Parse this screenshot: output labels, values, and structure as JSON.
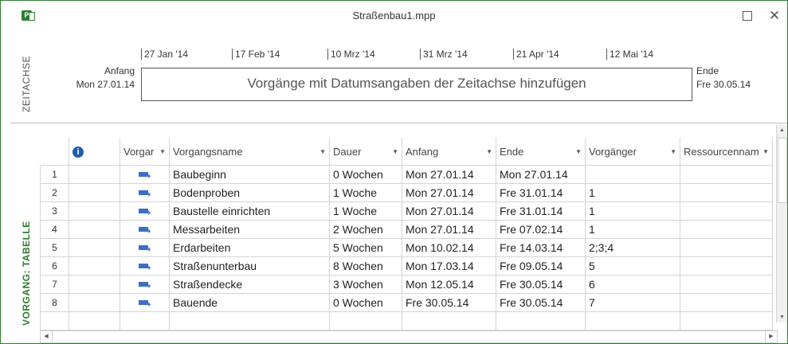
{
  "window": {
    "title": "Straßenbau1.mpp"
  },
  "timeline": {
    "side_label": "ZEITACHSE",
    "start_label": "Anfang",
    "start_date": "Mon 27.01.14",
    "end_label": "Ende",
    "end_date": "Fre 30.05.14",
    "hint": "Vorgänge mit Datumsangaben der Zeitachse hinzufügen",
    "ticks": [
      "27 Jan '14",
      "17 Feb '14",
      "10 Mrz '14",
      "31 Mrz '14",
      "21 Apr '14",
      "12 Mai '14"
    ]
  },
  "table": {
    "side_label": "VORGANG: TABELLE",
    "columns": {
      "info": "i",
      "mode": "Vorgar",
      "name": "Vorgangsname",
      "duration": "Dauer",
      "start": "Anfang",
      "finish": "Ende",
      "predecessors": "Vorgänger",
      "resources": "Ressourcennam"
    },
    "rows": [
      {
        "id": "1",
        "name": "Baubeginn",
        "duration": "0 Wochen",
        "start": "Mon 27.01.14",
        "finish": "Mon 27.01.14",
        "pred": ""
      },
      {
        "id": "2",
        "name": "Bodenproben",
        "duration": "1 Woche",
        "start": "Mon 27.01.14",
        "finish": "Fre 31.01.14",
        "pred": "1"
      },
      {
        "id": "3",
        "name": "Baustelle einrichten",
        "duration": "1 Woche",
        "start": "Mon 27.01.14",
        "finish": "Fre 31.01.14",
        "pred": "1"
      },
      {
        "id": "4",
        "name": "Messarbeiten",
        "duration": "2 Wochen",
        "start": "Mon 27.01.14",
        "finish": "Fre 07.02.14",
        "pred": "1"
      },
      {
        "id": "5",
        "name": "Erdarbeiten",
        "duration": "5 Wochen",
        "start": "Mon 10.02.14",
        "finish": "Fre 14.03.14",
        "pred": "2;3;4"
      },
      {
        "id": "6",
        "name": "Straßenunterbau",
        "duration": "8 Wochen",
        "start": "Mon 17.03.14",
        "finish": "Fre 09.05.14",
        "pred": "5"
      },
      {
        "id": "7",
        "name": "Straßendecke",
        "duration": "3 Wochen",
        "start": "Mon 12.05.14",
        "finish": "Fre 30.05.14",
        "pred": "6"
      },
      {
        "id": "8",
        "name": "Bauende",
        "duration": "0 Wochen",
        "start": "Fre 30.05.14",
        "finish": "Fre 30.05.14",
        "pred": "7"
      }
    ]
  },
  "icons": {
    "app": "project-file-icon",
    "task_mode": "auto-scheduled-task-icon",
    "info": "info-icon"
  },
  "colors": {
    "accent": "#2e7d32",
    "task_icon": "#3b6fc6",
    "info": "#1e5fa8"
  }
}
